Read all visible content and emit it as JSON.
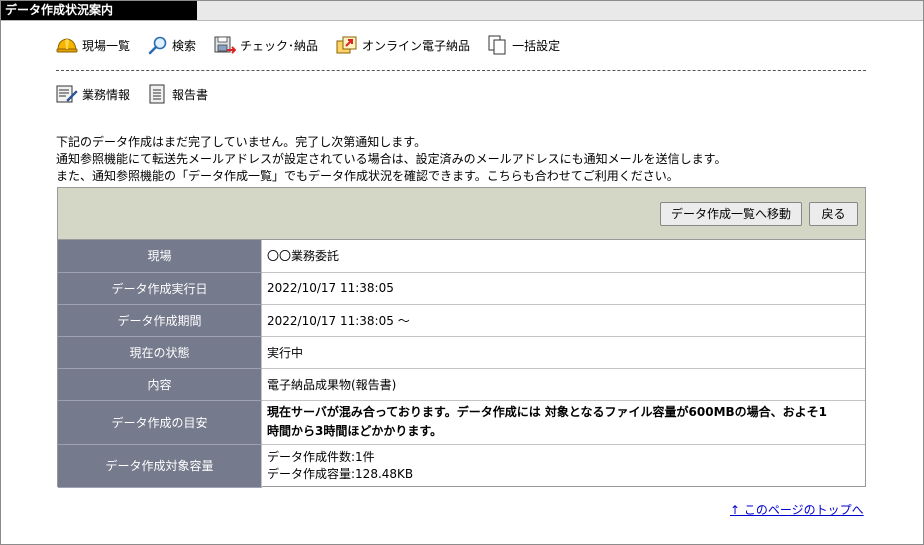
{
  "window": {
    "title": "データ作成状況案内"
  },
  "nav": {
    "row1": [
      {
        "label": "現場一覧",
        "icon": "helmet-icon"
      },
      {
        "label": "検索",
        "icon": "magnifier-icon"
      },
      {
        "label": "チェック･納品",
        "icon": "save-check-icon"
      },
      {
        "label": "オンライン電子納品",
        "icon": "online-delivery-icon"
      },
      {
        "label": "一括設定",
        "icon": "documents-icon"
      }
    ],
    "row2": [
      {
        "label": "業務情報",
        "icon": "edit-document-icon"
      },
      {
        "label": "報告書",
        "icon": "report-icon"
      }
    ]
  },
  "message": {
    "line1": "下記のデータ作成はまだ完了していません。完了し次第通知します。",
    "line2": "通知参照機能にて転送先メールアドレスが設定されている場合は、設定済みのメールアドレスにも通知メールを送信します。",
    "line3": "また、通知参照機能の「データ作成一覧」でもデータ作成状況を確認できます。こちらも合わせてご利用ください。"
  },
  "buttons": {
    "to_list": "データ作成一覧へ移動",
    "back": "戻る"
  },
  "table": {
    "rows": [
      {
        "label": "現場",
        "value": "〇〇業務委託"
      },
      {
        "label": "データ作成実行日",
        "value": "2022/10/17 11:38:05"
      },
      {
        "label": "データ作成期間",
        "value": "2022/10/17 11:38:05 ～"
      },
      {
        "label": "現在の状態",
        "value": "実行中"
      },
      {
        "label": "内容",
        "value": "電子納品成果物(報告書)"
      },
      {
        "label": "データ作成の目安",
        "value_line1": "現在サーバが混み合っております。データ作成には 対象となるファイル容量が600MBの場合、およそ1",
        "value_line2": "時間から3時間ほどかかります。"
      },
      {
        "label": "データ作成対象容量",
        "value_line1": "データ作成件数:1件",
        "value_line2": "データ作成容量:128.48KB"
      }
    ]
  },
  "footer": {
    "top_link": "↑ このページのトップへ"
  }
}
